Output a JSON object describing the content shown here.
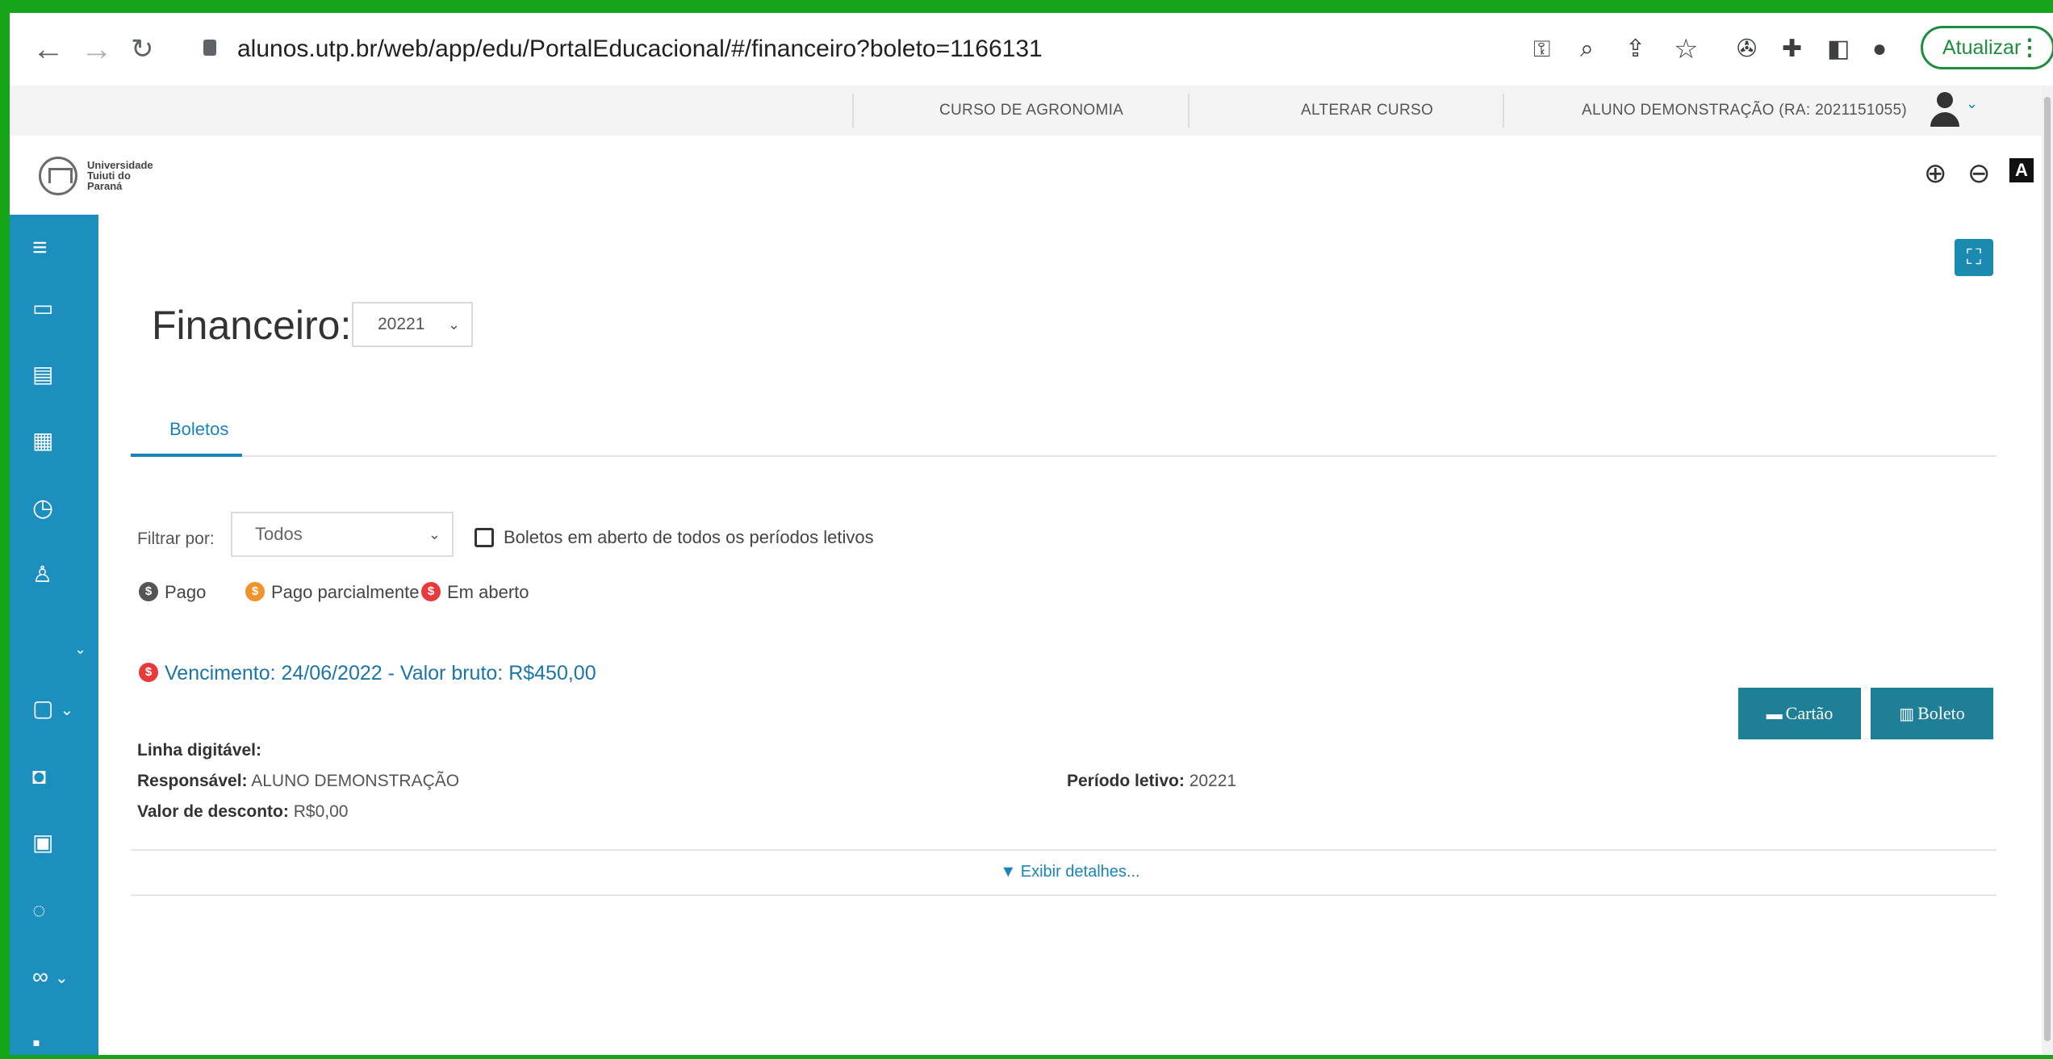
{
  "browser": {
    "url": "alunos.utp.br/web/app/edu/PortalEducacional/#/financeiro?boleto=1166131",
    "update_label": "Atualizar"
  },
  "header": {
    "course": "CURSO DE AGRONOMIA",
    "change_course": "ALTERAR CURSO",
    "student": "ALUNO DEMONSTRAÇÃO (RA: 2021151055)"
  },
  "logo": {
    "line1": "Universidade",
    "line2": "Tuiuti do",
    "line3": "Paraná"
  },
  "page": {
    "title": "Financeiro:",
    "period_value": "20221",
    "tab_boletos": "Boletos",
    "filter_label": "Filtrar por:",
    "filter_value": "Todos",
    "open_all_periods_label": "Boletos em aberto de todos os períodos letivos"
  },
  "legend": {
    "paid": "Pago",
    "partial": "Pago parcialmente",
    "open": "Em aberto"
  },
  "boleto": {
    "due_text": "Vencimento: 24/06/2022 - Valor bruto: R$450,00",
    "card_button": "Cartão",
    "boleto_button": "Boleto",
    "linha_label": "Linha digitável:",
    "responsavel_label": "Responsável:",
    "responsavel_value": "ALUNO DEMONSTRAÇÃO",
    "periodo_label": "Período letivo:",
    "periodo_value": "20221",
    "desconto_label": "Valor de desconto:",
    "desconto_value": "R$0,00",
    "details_link": "▼ Exibir detalhes..."
  },
  "colors": {
    "frame_green": "#16a418",
    "sidebar_blue": "#1d8fbe",
    "link_blue": "#1a84b6",
    "button_teal": "#1e7f97",
    "paid_gray": "#555555",
    "partial_orange": "#f0932b",
    "open_red": "#e83a3a"
  }
}
